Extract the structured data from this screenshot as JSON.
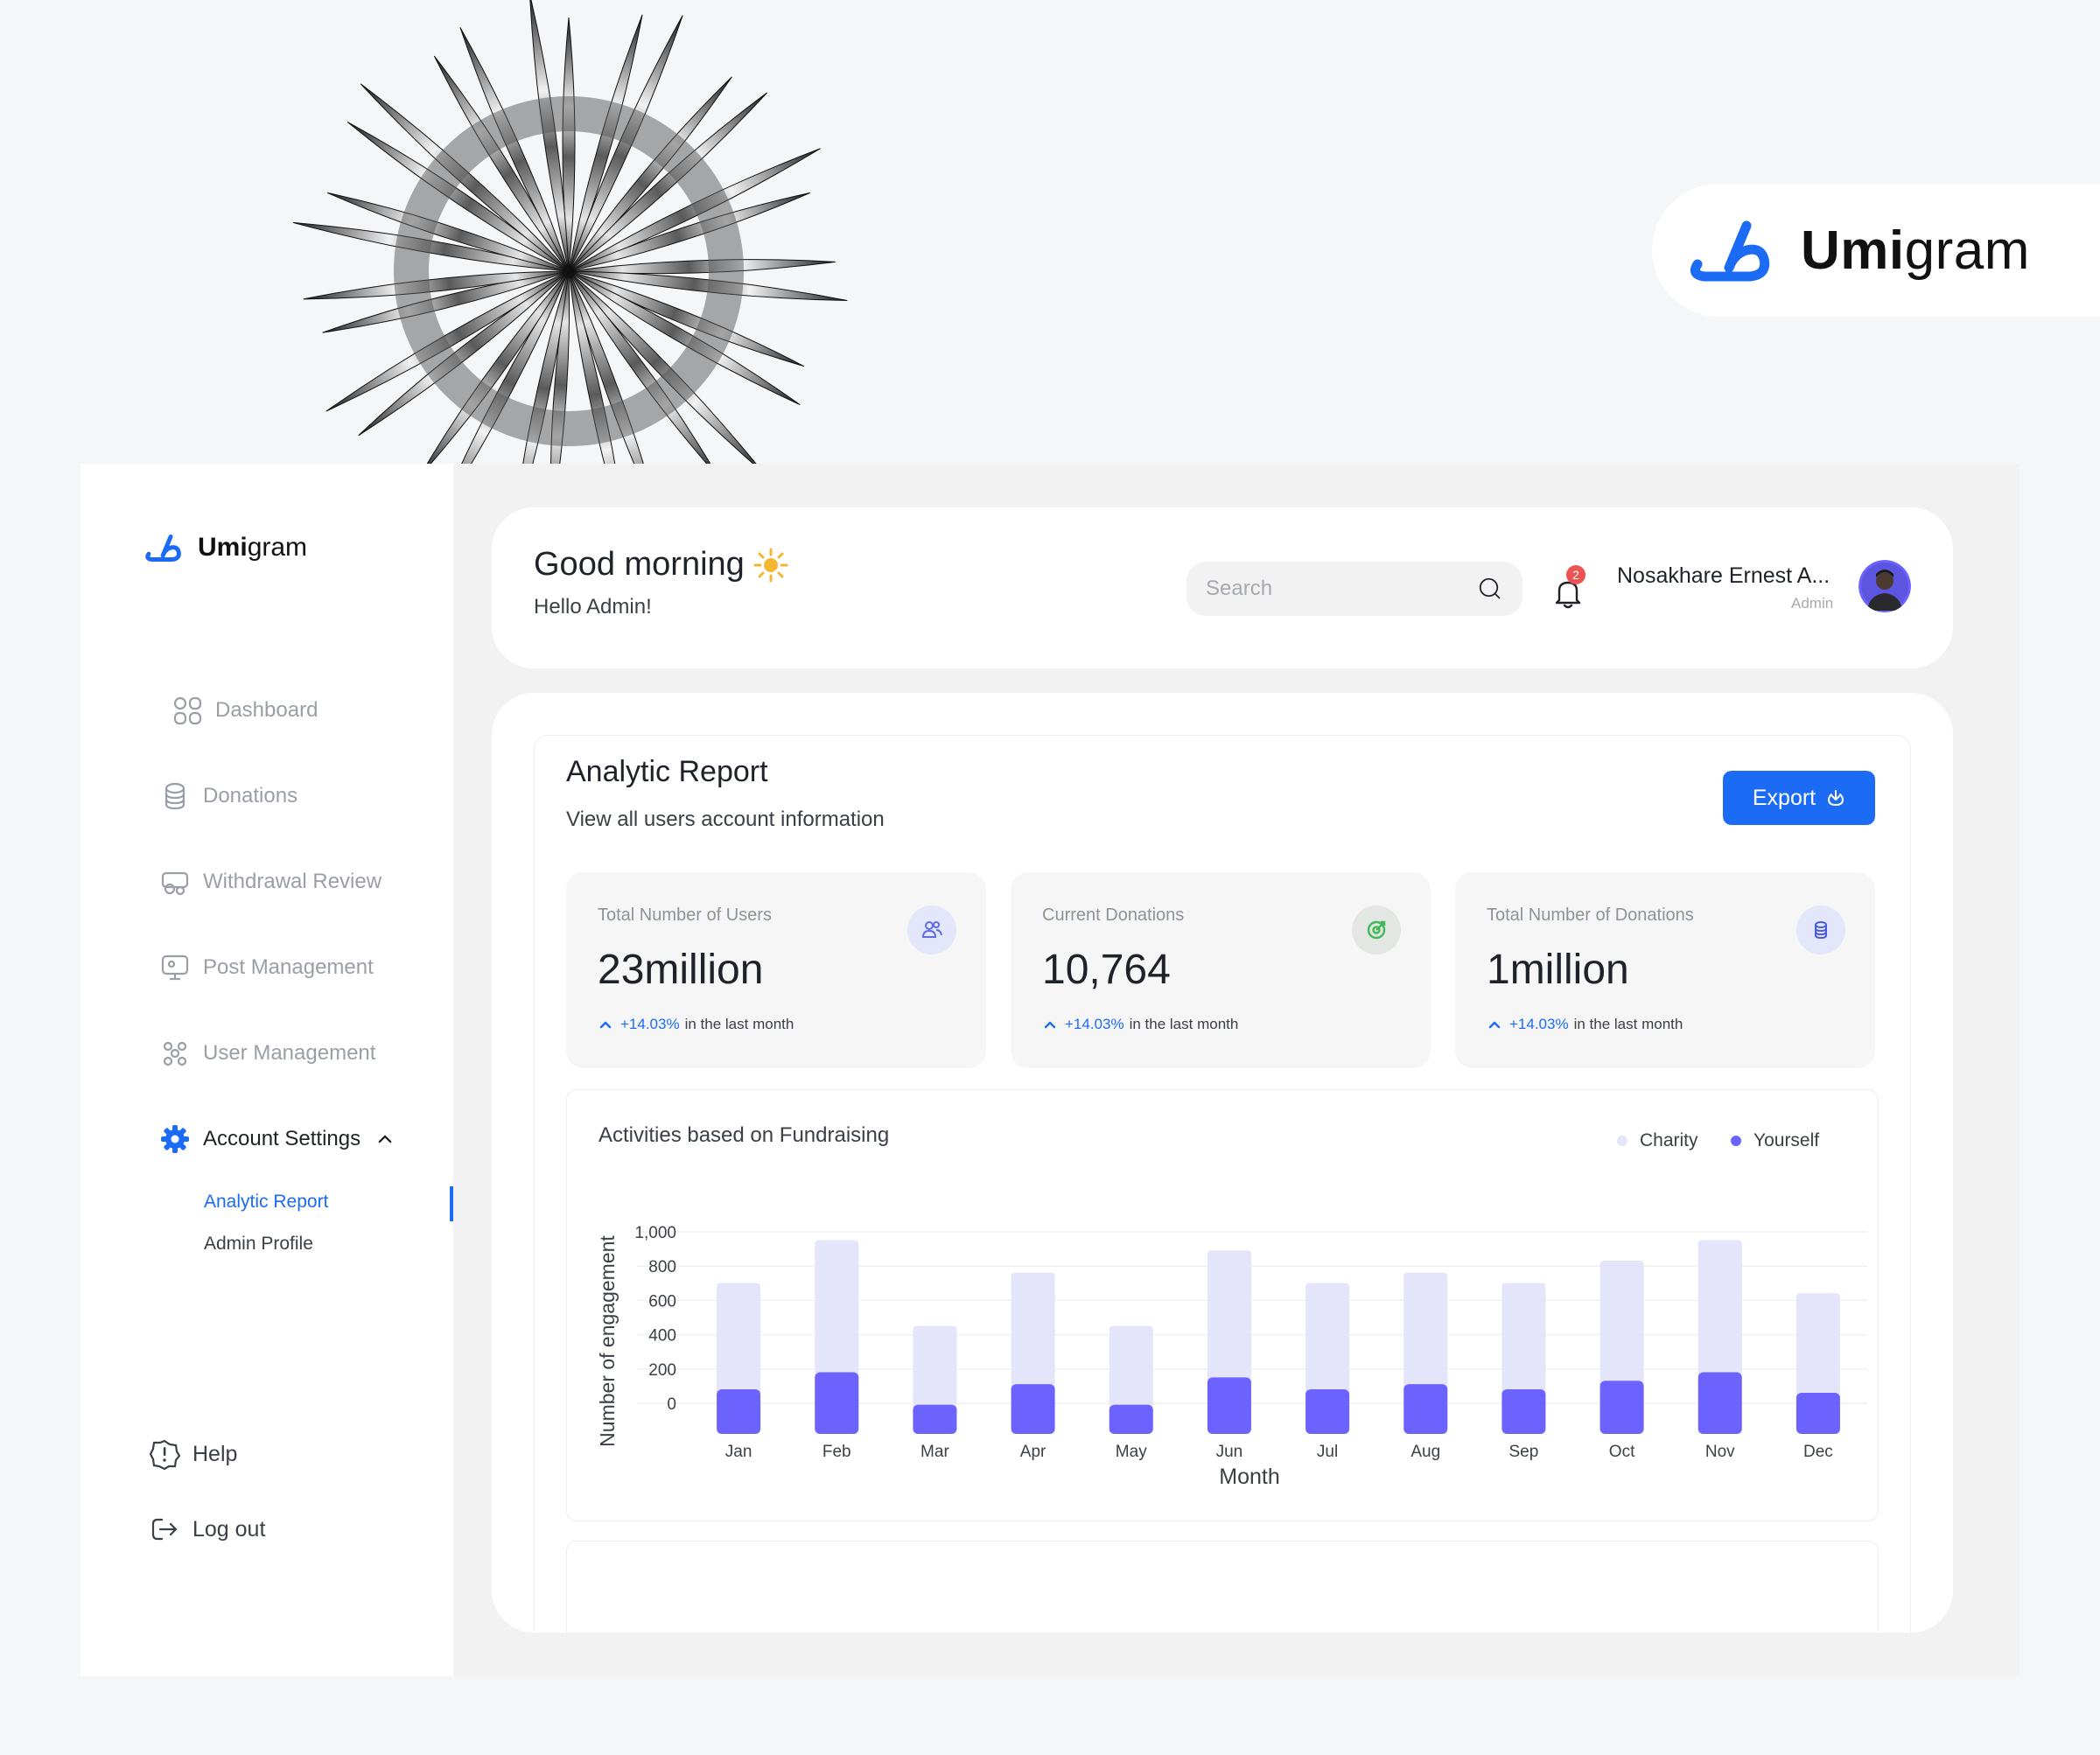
{
  "brand": {
    "name_bold": "Umi",
    "name_light": "gram"
  },
  "sidebar": {
    "items": [
      {
        "label": "Dashboard",
        "icon": "dashboard-icon"
      },
      {
        "label": "Donations",
        "icon": "coins-icon"
      },
      {
        "label": "Withdrawal Review",
        "icon": "withdrawal-icon"
      },
      {
        "label": "Post Management",
        "icon": "post-icon"
      },
      {
        "label": "User Management",
        "icon": "users-icon"
      },
      {
        "label": "Account Settings",
        "icon": "gear-icon"
      }
    ],
    "sub_items": [
      {
        "label": "Analytic Report"
      },
      {
        "label": "Admin Profile"
      }
    ],
    "help_label": "Help",
    "logout_label": "Log out"
  },
  "header": {
    "greeting": "Good morning",
    "subgreeting": "Hello Admin!",
    "search_placeholder": "Search",
    "notification_count": "2",
    "user_name": "Nosakhare Ernest A...",
    "user_role": "Admin"
  },
  "report": {
    "title": "Analytic Report",
    "subtitle": "View all users account information",
    "export_label": "Export"
  },
  "stats": [
    {
      "label": "Total Number of Users",
      "value": "23million",
      "change": "+14.03%",
      "suffix": "in the last month",
      "icon": "users-icon"
    },
    {
      "label": "Current Donations",
      "value": "10,764",
      "change": "+14.03%",
      "suffix": "in the last month",
      "icon": "target-icon"
    },
    {
      "label": "Total Number of Donations",
      "value": "1million",
      "change": "+14.03%",
      "suffix": "in the last month",
      "icon": "coins-icon"
    }
  ],
  "colors": {
    "accent": "#1c6bf5",
    "charity": "#e4e4fb",
    "yourself": "#6c63ff",
    "badge": "#ec5353"
  },
  "chart_data": {
    "type": "bar",
    "title": "Activities based on Fundraising",
    "xlabel": "Month",
    "ylabel": "Number of engagement",
    "categories": [
      "Jan",
      "Feb",
      "Mar",
      "Apr",
      "May",
      "Jun",
      "Jul",
      "Aug",
      "Sep",
      "Oct",
      "Nov",
      "Dec"
    ],
    "yticks": [
      "1,000",
      "800",
      "600",
      "400",
      "200",
      "0"
    ],
    "ylim": [
      0,
      1000
    ],
    "legend_position": "top-right",
    "series": [
      {
        "name": "Charity",
        "values": [
          880,
          1130,
          630,
          940,
          630,
          1070,
          880,
          940,
          880,
          1010,
          1130,
          820
        ]
      },
      {
        "name": "Yourself",
        "values": [
          260,
          360,
          170,
          290,
          170,
          330,
          260,
          290,
          260,
          310,
          360,
          240
        ]
      }
    ]
  }
}
